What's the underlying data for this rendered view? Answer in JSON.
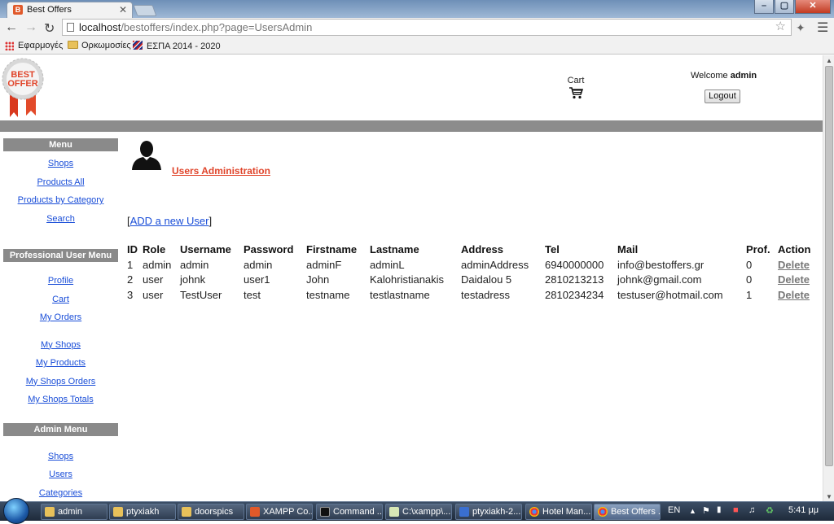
{
  "browser": {
    "tab_title": "Best Offers",
    "tab_close": "✕",
    "url_host": "localhost",
    "url_path": "/bestoffers/index.php?page=UsersAdmin",
    "window_buttons": [
      "–",
      "▢",
      "✕"
    ],
    "bookmarks": [
      "Εφαρμογές",
      "Ορκωμοσίες",
      "ΕΣΠΑ 2014 - 2020"
    ]
  },
  "header": {
    "logo_text": "BEST OFFER",
    "cart_label": "Cart",
    "welcome_prefix": "Welcome ",
    "welcome_user": "admin",
    "logout_label": "Logout"
  },
  "sidebar": {
    "menu_title": "Menu",
    "menu_items": [
      "Shops",
      "Products All",
      "Products by Category",
      "Search"
    ],
    "pro_title": "Professional User Menu",
    "pro_items": [
      "Profile",
      "Cart",
      "My Orders"
    ],
    "pro_items2": [
      "My Shops",
      "My Products",
      "My Shops Orders",
      "My Shops Totals"
    ],
    "admin_title": "Admin Menu",
    "admin_items": [
      "Shops",
      "Users",
      "Categories"
    ]
  },
  "main": {
    "title": "Users Administration",
    "add_prefix": "[",
    "add_link": "ADD a new User",
    "add_suffix": "]",
    "columns": [
      "ID",
      "Role",
      "Username",
      "Password",
      "Firstname",
      "Lastname",
      "Address",
      "Tel",
      "Mail",
      "Prof.",
      "Action"
    ],
    "rows": [
      [
        "1",
        "admin",
        "admin",
        "admin",
        "adminF",
        "adminL",
        "adminAddress",
        "6940000000",
        "info@bestoffers.gr",
        "0",
        "Delete"
      ],
      [
        "2",
        "user",
        "johnk",
        "user1",
        "John",
        "Kalohristianakis",
        "Daidalou 5",
        "2810213213",
        "johnk@gmail.com",
        "0",
        "Delete"
      ],
      [
        "3",
        "user",
        "TestUser",
        "test",
        "testname",
        "testlastname",
        "testadress",
        "2810234234",
        "testuser@hotmail.com",
        "1",
        "Delete"
      ]
    ]
  },
  "taskbar": {
    "items": [
      "admin",
      "ptyxiakh",
      "doorspics",
      "XAMPP Co...",
      "Command ...",
      "C:\\xampp\\...",
      "ptyxiakh-2...",
      "Hotel Man...",
      "Best Offers ..."
    ],
    "lang": "EN",
    "clock": "5:41 μμ"
  }
}
